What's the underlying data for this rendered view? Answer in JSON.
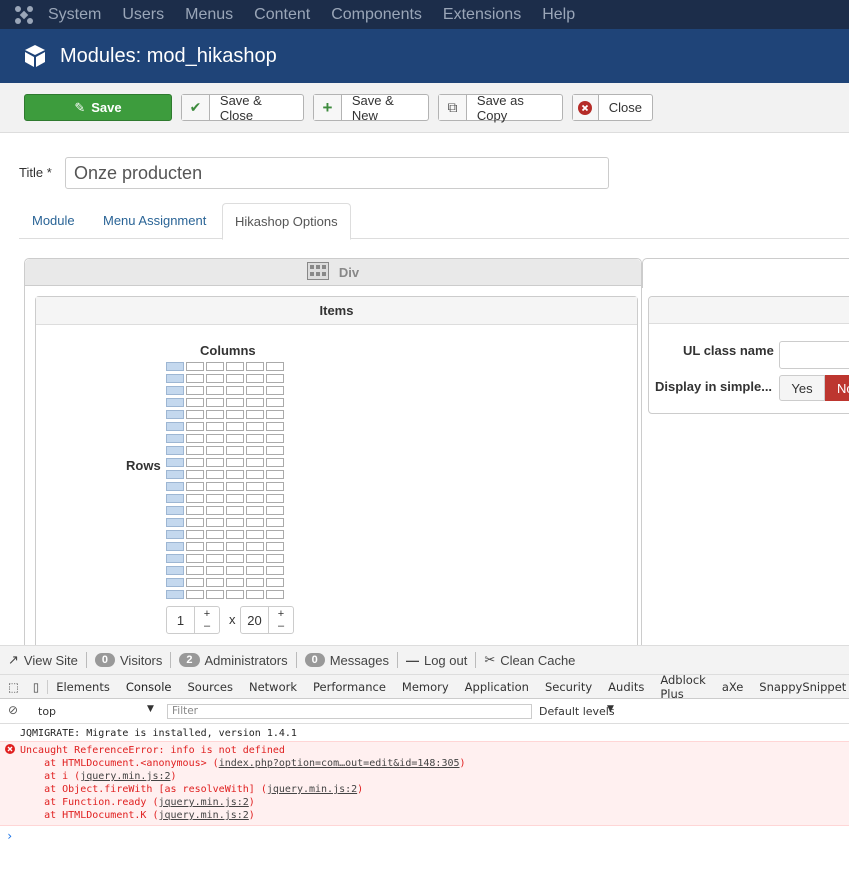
{
  "topnav": {
    "items": [
      "System",
      "Users",
      "Menus",
      "Content",
      "Components",
      "Extensions",
      "Help"
    ]
  },
  "header": {
    "title": "Modules: mod_hikashop"
  },
  "toolbar": {
    "save": "Save",
    "save_close": "Save & Close",
    "save_new": "Save & New",
    "save_copy": "Save as Copy",
    "close": "Close"
  },
  "form": {
    "title_label": "Title *",
    "title_value": "Onze producten"
  },
  "tabs": [
    "Module",
    "Menu Assignment",
    "Hikashop Options"
  ],
  "panel": {
    "div_label": "Div",
    "items_title": "Items",
    "columns_label": "Columns",
    "rows_label": "Rows",
    "columns_value": "1",
    "times": "x",
    "rows_value": "20",
    "ul_class_label": "UL class name",
    "display_simple_label": "Display in simple...",
    "yes": "Yes",
    "no": "No"
  },
  "statusbar": {
    "view_site": "View Site",
    "visitors_count": "0",
    "visitors": "Visitors",
    "admins_count": "2",
    "admins": "Administrators",
    "messages_count": "0",
    "messages": "Messages",
    "logout": "Log out",
    "clean_cache": "Clean Cache"
  },
  "devtools": {
    "tabs": [
      "Elements",
      "Console",
      "Sources",
      "Network",
      "Performance",
      "Memory",
      "Application",
      "Security",
      "Audits",
      "Adblock Plus",
      "aXe",
      "SnappySnippet"
    ],
    "context": "top",
    "filter_placeholder": "Filter",
    "levels": "Default levels",
    "log_line": "JQMIGRATE: Migrate is installed, version 1.4.1",
    "error_title": "Uncaught ReferenceError: info is not defined",
    "trace": [
      {
        "prefix": "    at HTMLDocument.<anonymous> (",
        "link": "index.php?option=com…out=edit&id=148:305",
        "suffix": ")"
      },
      {
        "prefix": "    at i (",
        "link": "jquery.min.js:2",
        "suffix": ")"
      },
      {
        "prefix": "    at Object.fireWith [as resolveWith] (",
        "link": "jquery.min.js:2",
        "suffix": ")"
      },
      {
        "prefix": "    at Function.ready (",
        "link": "jquery.min.js:2",
        "suffix": ")"
      },
      {
        "prefix": "    at HTMLDocument.K (",
        "link": "jquery.min.js:2",
        "suffix": ")"
      }
    ],
    "prompt": "›"
  }
}
